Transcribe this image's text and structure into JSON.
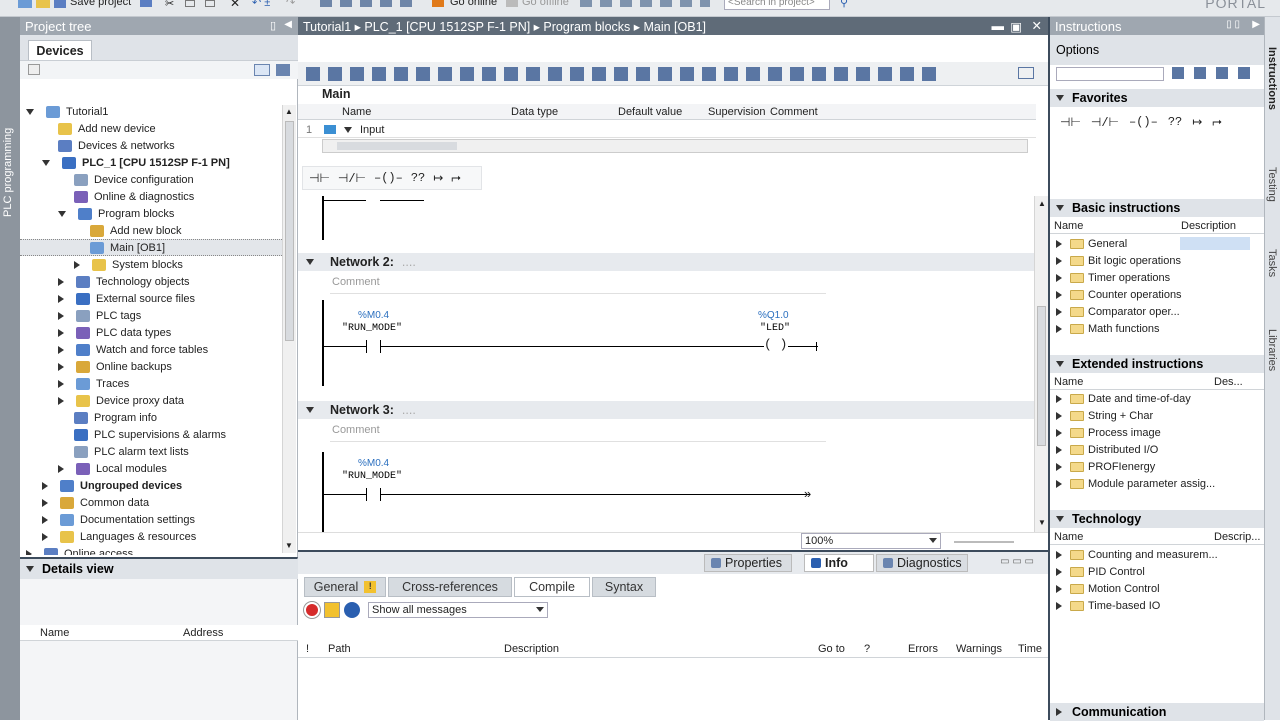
{
  "toolbar": {
    "save_label": "Save project",
    "go_online": "Go online",
    "go_offline": "Go offline",
    "search_placeholder": "<Search in project>",
    "brand": "PORTAL"
  },
  "sidebar": {
    "vertical_label": "PLC programming"
  },
  "project_tree": {
    "title": "Project tree",
    "devices_tab": "Devices",
    "items": [
      {
        "label": "Tutorial1",
        "indent": 0,
        "expander": "down",
        "bold": false
      },
      {
        "label": "Add new device",
        "indent": 1,
        "expander": "none",
        "bold": false
      },
      {
        "label": "Devices & networks",
        "indent": 1,
        "expander": "none",
        "bold": false
      },
      {
        "label": "PLC_1 [CPU 1512SP F-1 PN]",
        "indent": 1,
        "expander": "down",
        "bold": true
      },
      {
        "label": "Device configuration",
        "indent": 2,
        "expander": "none",
        "bold": false
      },
      {
        "label": "Online & diagnostics",
        "indent": 2,
        "expander": "none",
        "bold": false
      },
      {
        "label": "Program blocks",
        "indent": 2,
        "expander": "down",
        "bold": false
      },
      {
        "label": "Add new block",
        "indent": 3,
        "expander": "none",
        "bold": false
      },
      {
        "label": "Main [OB1]",
        "indent": 3,
        "expander": "none",
        "bold": false,
        "selected": true
      },
      {
        "label": "System blocks",
        "indent": 3,
        "expander": "right",
        "bold": false
      },
      {
        "label": "Technology objects",
        "indent": 2,
        "expander": "right",
        "bold": false
      },
      {
        "label": "External source files",
        "indent": 2,
        "expander": "right",
        "bold": false
      },
      {
        "label": "PLC tags",
        "indent": 2,
        "expander": "right",
        "bold": false
      },
      {
        "label": "PLC data types",
        "indent": 2,
        "expander": "right",
        "bold": false
      },
      {
        "label": "Watch and force tables",
        "indent": 2,
        "expander": "right",
        "bold": false
      },
      {
        "label": "Online backups",
        "indent": 2,
        "expander": "right",
        "bold": false
      },
      {
        "label": "Traces",
        "indent": 2,
        "expander": "right",
        "bold": false
      },
      {
        "label": "Device proxy data",
        "indent": 2,
        "expander": "right",
        "bold": false
      },
      {
        "label": "Program info",
        "indent": 2,
        "expander": "none",
        "bold": false
      },
      {
        "label": "PLC supervisions & alarms",
        "indent": 2,
        "expander": "none",
        "bold": false
      },
      {
        "label": "PLC alarm text lists",
        "indent": 2,
        "expander": "none",
        "bold": false
      },
      {
        "label": "Local modules",
        "indent": 2,
        "expander": "right",
        "bold": false
      },
      {
        "label": "Ungrouped devices",
        "indent": 1,
        "expander": "right",
        "bold": true
      },
      {
        "label": "Common data",
        "indent": 1,
        "expander": "right",
        "bold": false
      },
      {
        "label": "Documentation settings",
        "indent": 1,
        "expander": "right",
        "bold": false
      },
      {
        "label": "Languages & resources",
        "indent": 1,
        "expander": "right",
        "bold": false
      },
      {
        "label": "Online access",
        "indent": 0,
        "expander": "right",
        "bold": false
      }
    ]
  },
  "details_view": {
    "title": "Details view",
    "col_name": "Name",
    "col_address": "Address"
  },
  "editor": {
    "title": "Main",
    "iface_cols": [
      "Name",
      "Data type",
      "Default value",
      "Supervision",
      "Comment"
    ],
    "iface_row": {
      "num": "1",
      "name": "Input"
    },
    "lad_symbols": [
      "⊣⊢",
      "⊣/⊢",
      "–()–",
      "??",
      "↦",
      "⮣"
    ],
    "networks": [
      {
        "label": "Network 2:",
        "dots": "....",
        "comment": "Comment",
        "contact_addr": "%M0.4",
        "contact_name": "\"RUN_MODE\"",
        "coil_addr": "%Q1.0",
        "coil_name": "\"LED\""
      },
      {
        "label": "Network 3:",
        "dots": "....",
        "comment": "Comment",
        "contact_addr": "%M0.4",
        "contact_name": "\"RUN_MODE\""
      }
    ],
    "zoom": "100%"
  },
  "inspector": {
    "properties": "Properties",
    "info": "Info",
    "diagnostics": "Diagnostics",
    "tabs": [
      "General",
      "Cross-references",
      "Compile",
      "Syntax"
    ],
    "filter": "Show all messages",
    "cols": [
      "!",
      "Path",
      "Description",
      "Go to",
      "?",
      "Errors",
      "Warnings",
      "Time"
    ]
  },
  "instructions": {
    "title": "Instructions",
    "options": "Options",
    "favorites": "Favorites",
    "basic": {
      "title": "Basic instructions",
      "col_name": "Name",
      "col_desc": "Description",
      "items": [
        "General",
        "Bit logic operations",
        "Timer operations",
        "Counter operations",
        "Comparator oper...",
        "Math functions"
      ]
    },
    "extended": {
      "title": "Extended instructions",
      "col_name": "Name",
      "col_desc": "Des...",
      "items": [
        "Date and time-of-day",
        "String + Char",
        "Process image",
        "Distributed I/O",
        "PROFIenergy",
        "Module parameter assig..."
      ]
    },
    "technology": {
      "title": "Technology",
      "col_name": "Name",
      "col_desc": "Descrip...",
      "items": [
        "Counting and measurem...",
        "PID Control",
        "Motion Control",
        "Time-based IO"
      ]
    },
    "communication": "Communication"
  },
  "right_tabs": [
    "Instructions",
    "Testing",
    "Tasks",
    "Libraries"
  ]
}
